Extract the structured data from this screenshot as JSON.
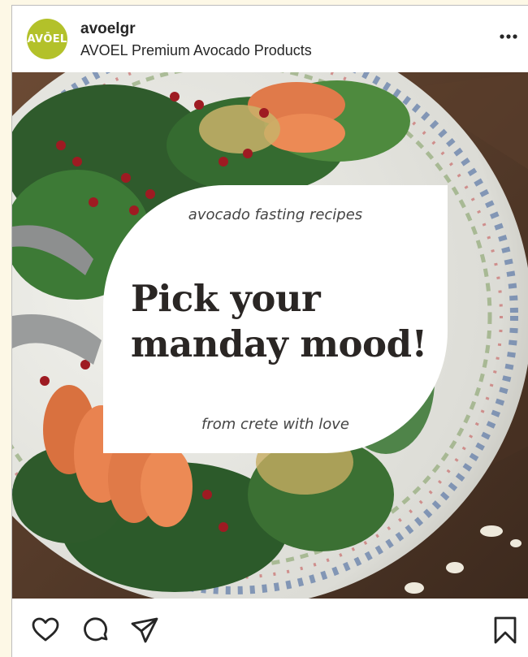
{
  "post": {
    "username": "avoelgr",
    "account_name": "AVOEL Premium Avocado Products",
    "avatar_text": "AVŌEL",
    "avatar_color": "#b3c12a",
    "more_icon": "more-horizontal-icon"
  },
  "image_card": {
    "kicker": "avocado fasting recipes",
    "headline_line1": "Pick your",
    "headline_line2": "manday mood!",
    "footer": "from crete with love"
  },
  "actions": {
    "icons": [
      "heart-icon",
      "comment-icon",
      "share-icon",
      "bookmark-icon"
    ]
  }
}
